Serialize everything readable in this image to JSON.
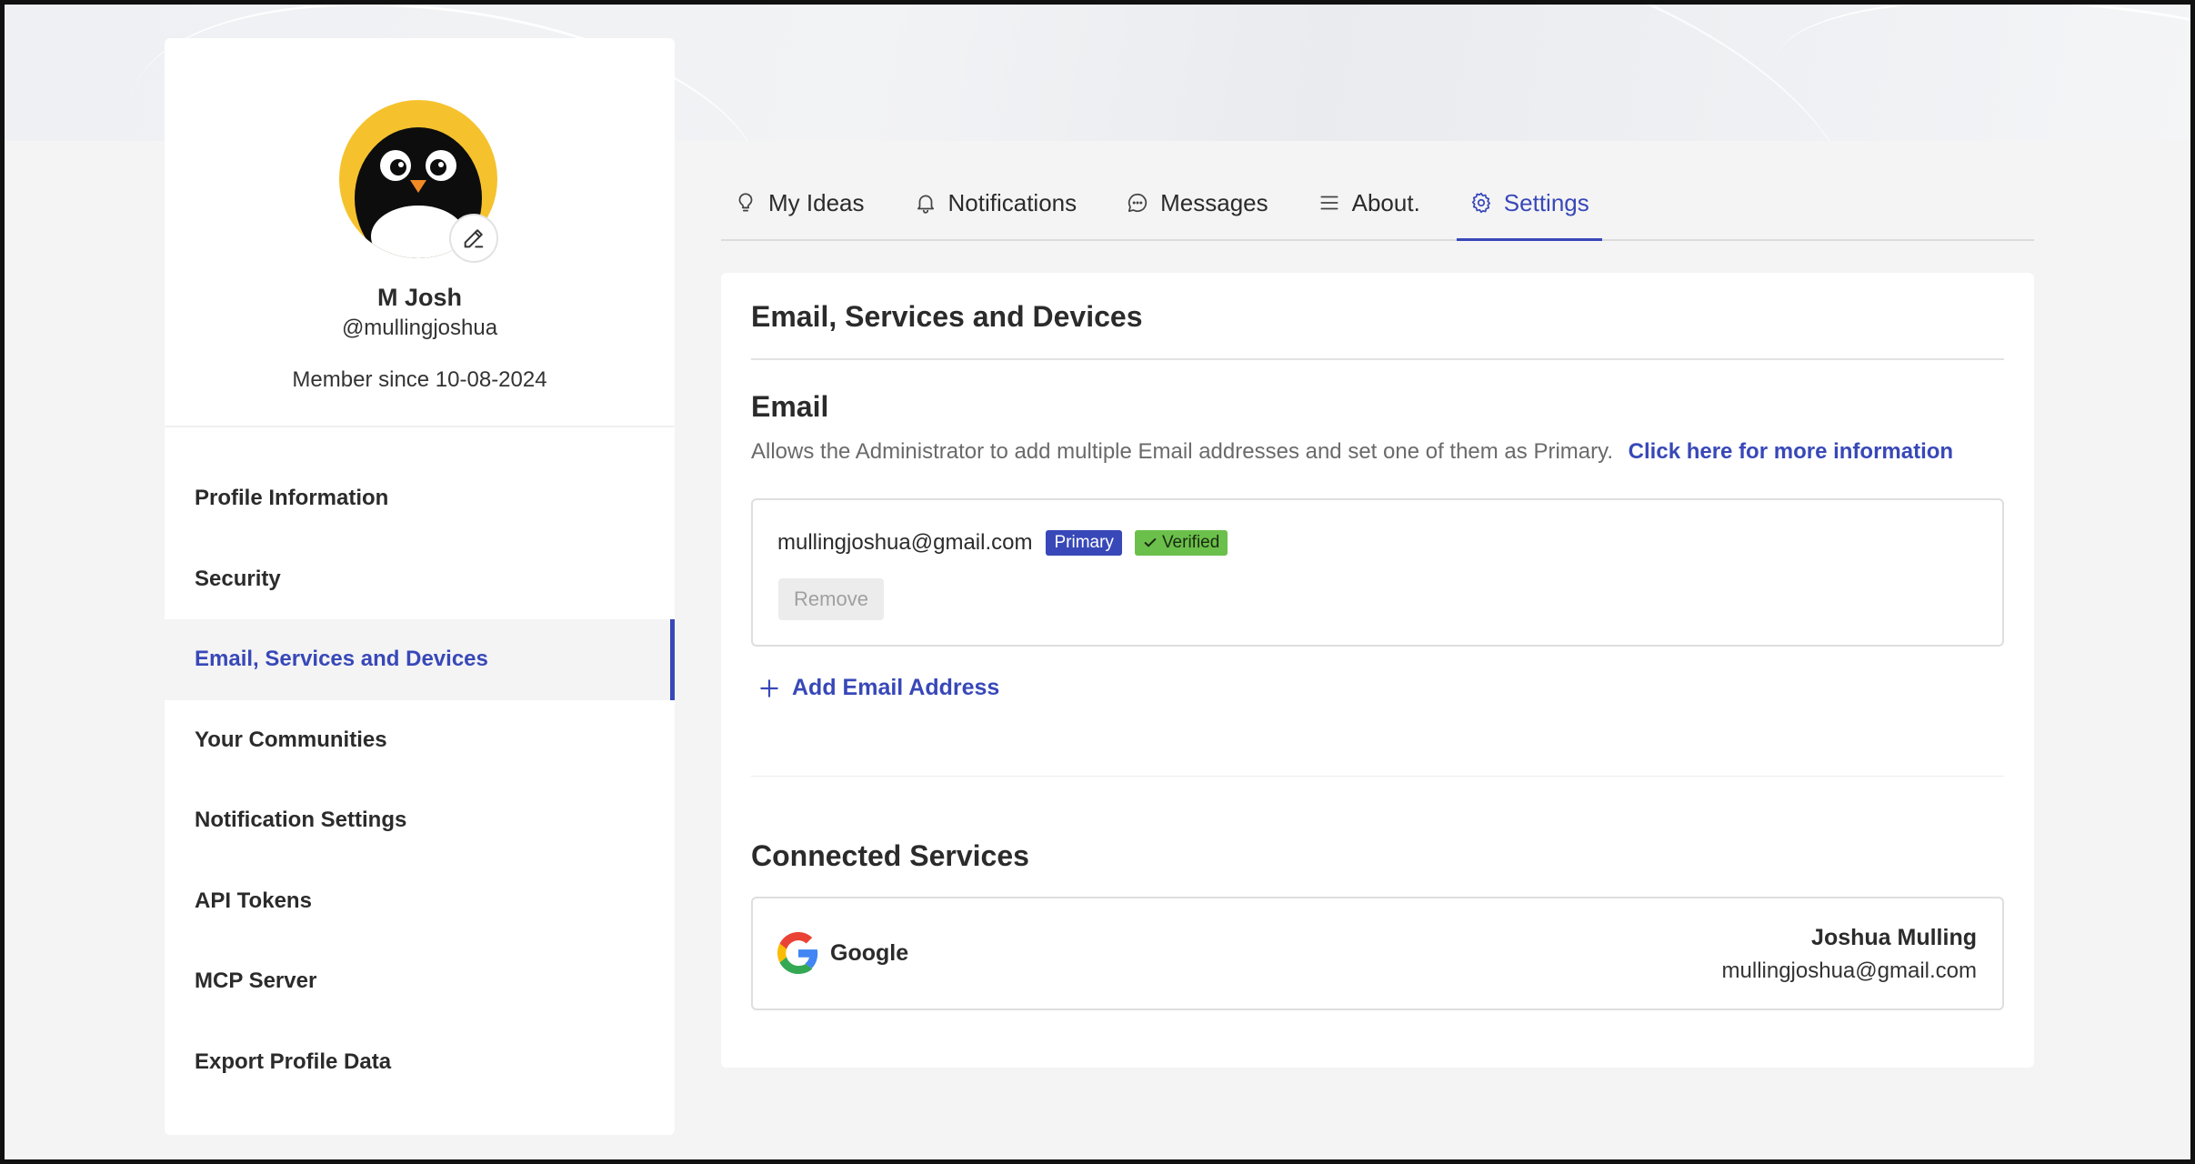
{
  "profile": {
    "name": "M Josh",
    "handle": "@mullingjoshua",
    "member_since": "Member since 10-08-2024",
    "avatar_icon": "penguin-avatar",
    "avatar_color": "#f5c22e"
  },
  "sidebar": {
    "items": [
      {
        "label": "Profile Information",
        "active": false
      },
      {
        "label": "Security",
        "active": false
      },
      {
        "label": "Email, Services and Devices",
        "active": true
      },
      {
        "label": "Your Communities",
        "active": false
      },
      {
        "label": "Notification Settings",
        "active": false
      },
      {
        "label": "API Tokens",
        "active": false
      },
      {
        "label": "MCP Server",
        "active": false
      },
      {
        "label": "Export Profile Data",
        "active": false
      }
    ]
  },
  "tabs": [
    {
      "label": "My Ideas",
      "icon": "lightbulb-icon",
      "active": false
    },
    {
      "label": "Notifications",
      "icon": "bell-icon",
      "active": false
    },
    {
      "label": "Messages",
      "icon": "chat-bubble-icon",
      "active": false
    },
    {
      "label": "About.",
      "icon": "menu-lines-icon",
      "active": false
    },
    {
      "label": "Settings",
      "icon": "gear-icon",
      "active": true
    }
  ],
  "main": {
    "title": "Email, Services and Devices",
    "email_section": {
      "title": "Email",
      "description": "Allows the Administrator to add multiple Email addresses and set one of them as Primary.",
      "info_link": "Click here for more information",
      "emails": [
        {
          "address": "mullingjoshua@gmail.com",
          "primary_label": "Primary",
          "verified_label": "Verified",
          "remove_label": "Remove"
        }
      ],
      "add_label": "Add Email Address"
    },
    "services_section": {
      "title": "Connected Services",
      "services": [
        {
          "name": "Google",
          "icon": "google-icon",
          "user": "Joshua Mulling",
          "email": "mullingjoshua@gmail.com"
        }
      ]
    }
  },
  "colors": {
    "accent": "#3848b8",
    "verified": "#6bc04b",
    "background": "#f4f4f5"
  }
}
